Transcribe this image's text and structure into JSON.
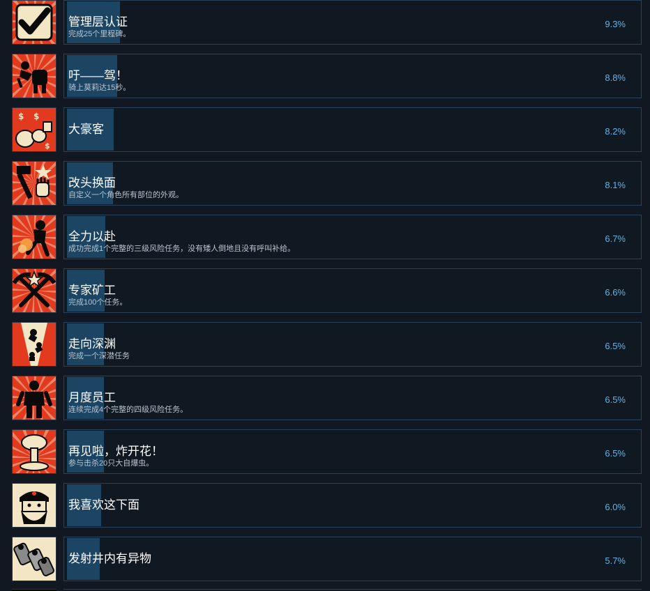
{
  "colors": {
    "page_bg": "#111821",
    "panel_border": "#2b4259",
    "progress_fill": "#1c4564",
    "percent_text": "#63b3e8",
    "icon_red": "#e23a1f",
    "icon_cream": "#f3e6c4"
  },
  "achievements": [
    {
      "title": "管理层认证",
      "desc": "完成25个里程碑。",
      "percent": "9.3%",
      "value": 9.3,
      "icon": "checkmark-icon"
    },
    {
      "title": "吁——驾！",
      "desc": "骑上莫莉达15秒。",
      "percent": "8.8%",
      "value": 8.8,
      "icon": "dwarf-riding-robot-icon"
    },
    {
      "title": "大豪客",
      "desc": "",
      "percent": "8.2%",
      "value": 8.2,
      "icon": "money-bags-icon"
    },
    {
      "title": "改头换面",
      "desc": "自定义一个角色所有部位的外观。",
      "percent": "8.1%",
      "value": 8.1,
      "icon": "hammer-and-fist-icon"
    },
    {
      "title": "全力以赴",
      "desc": "成功完成1个完整的三级风险任务，没有矮人倒地且没有呼叫补给。",
      "percent": "6.7%",
      "value": 6.7,
      "icon": "running-dwarf-icon"
    },
    {
      "title": "专家矿工",
      "desc": "完成100个任务。",
      "percent": "6.6%",
      "value": 6.6,
      "icon": "crossed-pickaxes-icon"
    },
    {
      "title": "走向深渊",
      "desc": "完成一个深潜任务",
      "percent": "6.5%",
      "value": 6.5,
      "icon": "falling-dwarves-icon"
    },
    {
      "title": "月度员工",
      "desc": "连续完成4个完整的四级风险任务。",
      "percent": "6.5%",
      "value": 6.5,
      "icon": "standing-dwarf-icon"
    },
    {
      "title": "再见啦，炸开花！",
      "desc": "参与击杀20只大自爆虫。",
      "percent": "6.5%",
      "value": 6.5,
      "icon": "mushroom-cloud-icon"
    },
    {
      "title": "我喜欢这下面",
      "desc": "",
      "percent": "6.0%",
      "value": 6.0,
      "icon": "bearded-dwarf-face-icon"
    },
    {
      "title": "发射井内有异物",
      "desc": "",
      "percent": "5.7%",
      "value": 5.7,
      "icon": "canisters-icon"
    }
  ]
}
